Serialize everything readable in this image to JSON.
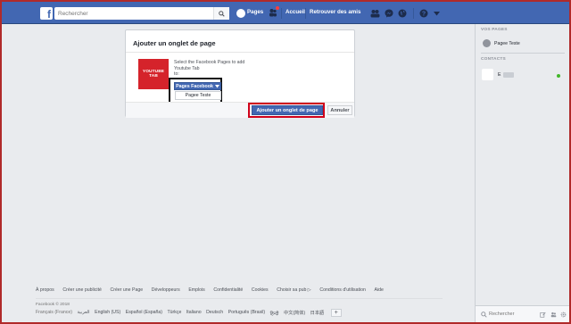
{
  "topbar": {
    "logo": "f",
    "search_placeholder": "Rechercher",
    "profile_label": "Pages",
    "home_label": "Accueil",
    "find_friends_label": "Retrouver des amis"
  },
  "dialog": {
    "title": "Ajouter un onglet de page",
    "app_image_text": "YOUTUBE TAB",
    "instruction": "Select the Facebook Pages to add",
    "app_name": "Youtube Tab",
    "to_label": "to:",
    "dropdown_label": "Pages Facebook",
    "dropdown_option": "Pagee Teste",
    "primary_button": "Ajouter un onglet de page",
    "cancel_button": "Annuler"
  },
  "sidebar": {
    "pages_heading": "VOS PAGES",
    "page_item": "Pagee Teste",
    "contacts_heading": "CONTACTS",
    "contact_initial": "E",
    "search_placeholder": "Rechercher"
  },
  "footer": {
    "links": [
      "À propos",
      "Créer une publicité",
      "Créer une Page",
      "Développeurs",
      "Emplois",
      "Confidentialité",
      "Cookies",
      "Choisir sa pub ▷",
      "Conditions d'utilisation",
      "Aide"
    ],
    "copyright": "Facebook © 2018",
    "languages": [
      "Français (France)",
      "العربية",
      "English (US)",
      "Español (España)",
      "Türkçe",
      "Italiano",
      "Deutsch",
      "Português (Brasil)",
      "हिन्दी",
      "中文(简体)",
      "日本語"
    ],
    "more_languages": "+"
  },
  "colors": {
    "brand": "#4267b2",
    "highlight_red": "#d0021b",
    "frame": "#b02a2a",
    "app_red": "#d5232b",
    "online": "#42b72a"
  }
}
